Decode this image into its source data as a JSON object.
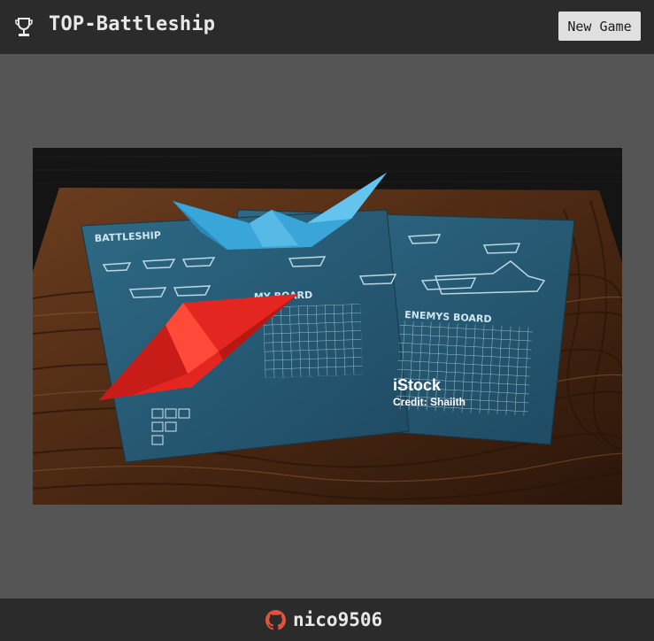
{
  "header": {
    "icon": "trophy-icon",
    "title": "TOP-Battleship",
    "new_game_label": "New Game"
  },
  "hero": {
    "watermark_brand": "iStock",
    "watermark_credit": "Credit: Shaiith",
    "sheet_labels": {
      "sheet_title": "BATTLESHIP",
      "my_board": "MY BOARD",
      "enemy_board": "ENEMYS BOARD"
    }
  },
  "footer": {
    "icon": "github-icon",
    "username": "nico9506"
  },
  "colors": {
    "header_bg": "#2b2b2b",
    "page_bg": "#555555",
    "button_bg": "#e0e0e0",
    "text_light": "#e8e8e8",
    "github_icon": "#e0533d"
  }
}
